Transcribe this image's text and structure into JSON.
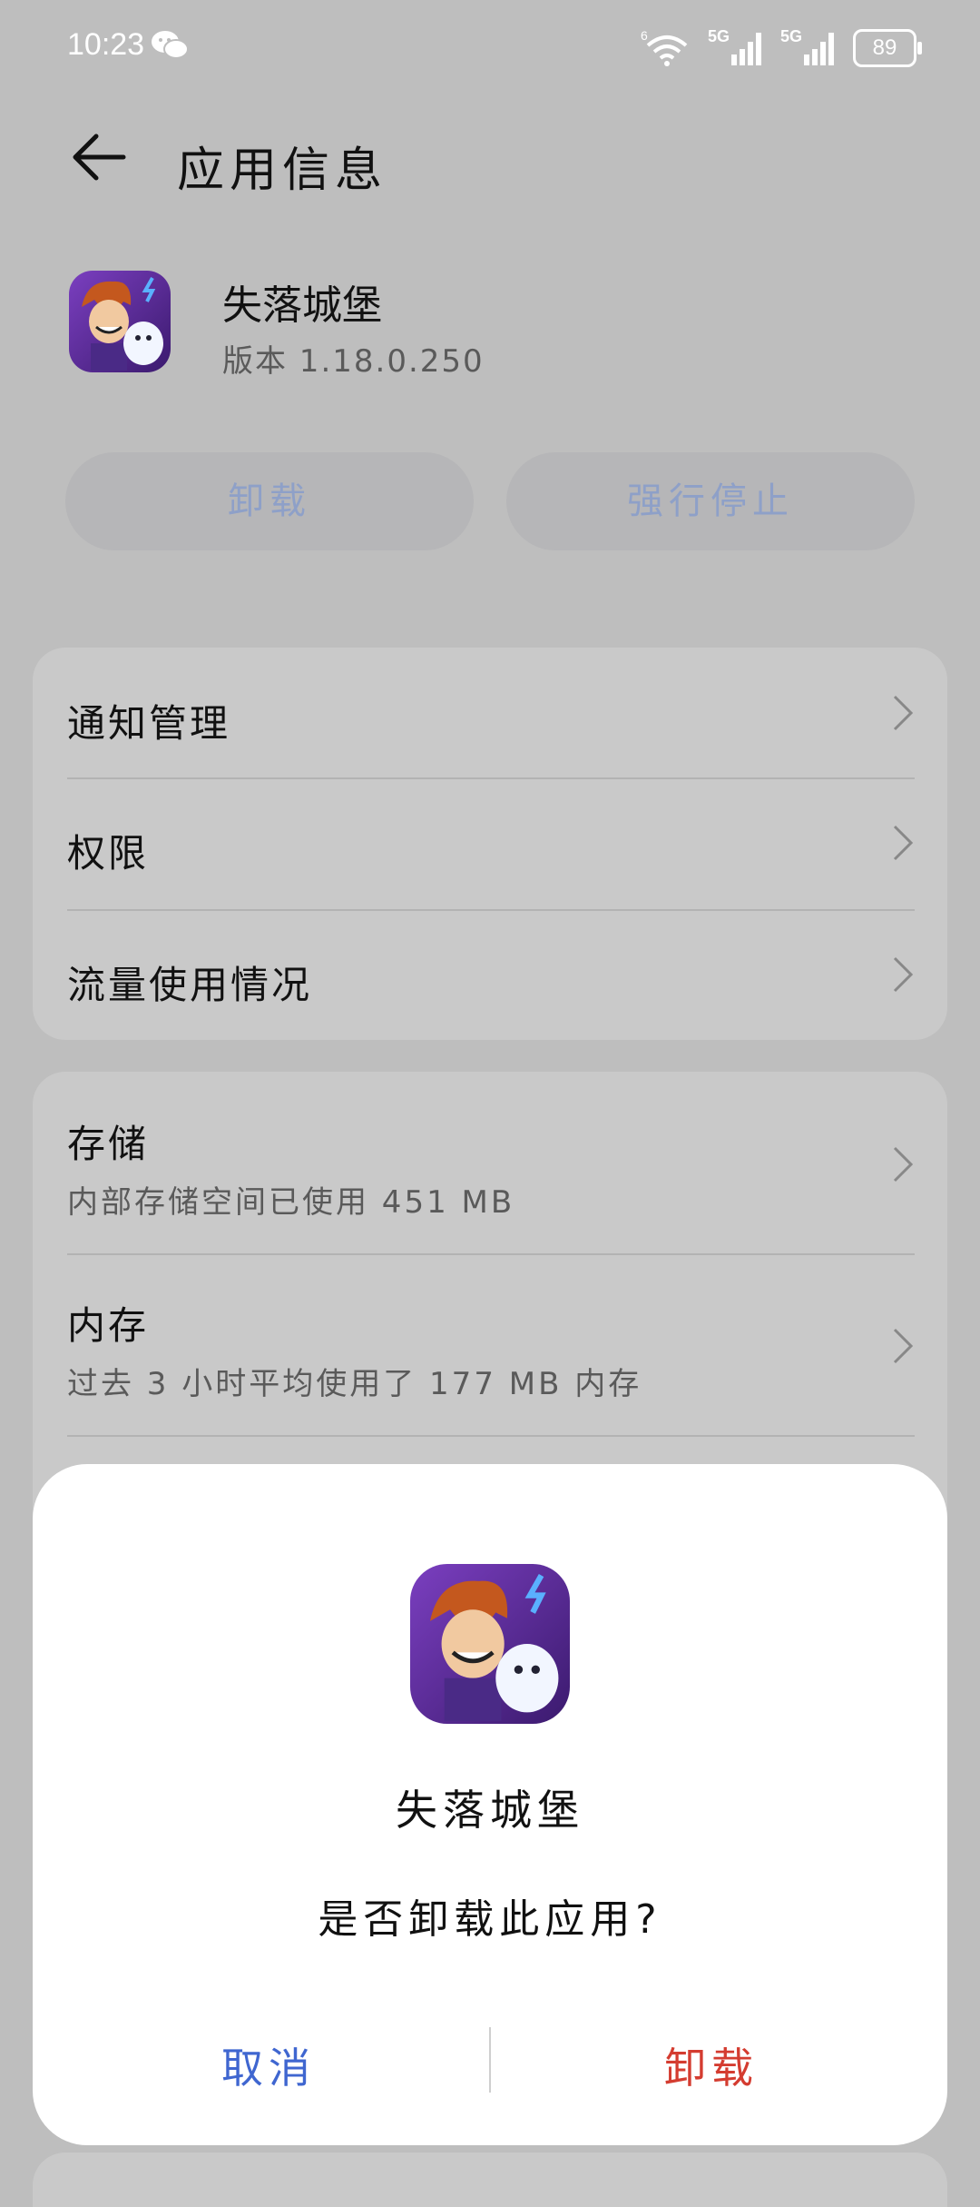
{
  "status_bar": {
    "time": "10:23",
    "network_1": "5G",
    "network_2": "5G",
    "wifi_tag": "6",
    "battery": "89"
  },
  "header": {
    "title": "应用信息"
  },
  "app": {
    "name": "失落城堡",
    "version": "版本 1.18.0.250"
  },
  "actions": {
    "uninstall": "卸载",
    "force_stop": "强行停止"
  },
  "settings_group_1": [
    {
      "label": "通知管理"
    },
    {
      "label": "权限"
    },
    {
      "label": "流量使用情况"
    }
  ],
  "settings_group_2": [
    {
      "label": "存储",
      "sub": "内部存储空间已使用 451 MB"
    },
    {
      "label": "内存",
      "sub": "过去 3 小时平均使用了 177 MB 内存"
    }
  ],
  "dialog": {
    "app_name": "失落城堡",
    "question": "是否卸载此应用?",
    "cancel": "取消",
    "confirm": "卸载"
  },
  "colors": {
    "accent_blue": "#3f66d0",
    "danger_red": "#d43c30",
    "overlay_bg": "#bebebe"
  }
}
